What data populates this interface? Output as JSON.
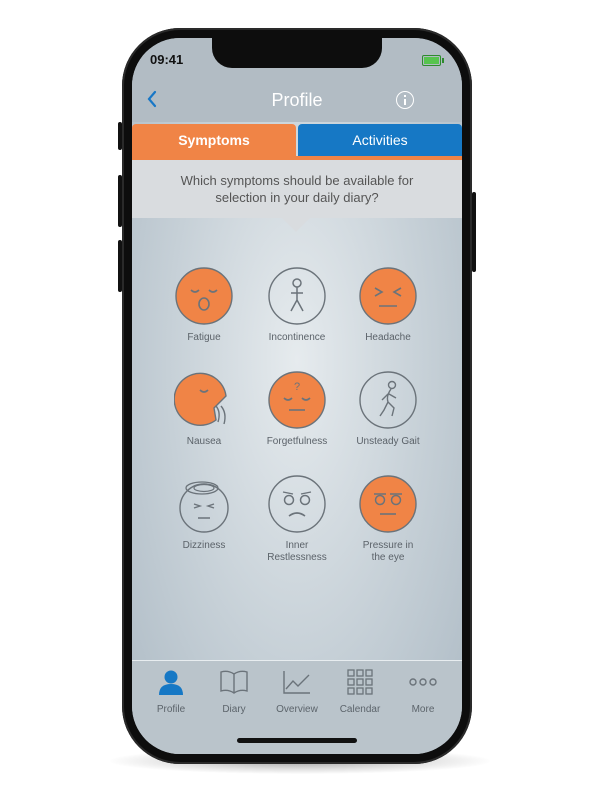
{
  "status_bar": {
    "time": "09:41"
  },
  "header": {
    "title": "Profile"
  },
  "tabs": [
    {
      "label": "Symptoms",
      "active": true
    },
    {
      "label": "Activities",
      "active": false
    }
  ],
  "question": "Which symptoms should be available for selection in your daily diary?",
  "symptoms": [
    {
      "label": "Fatigue",
      "selected": true
    },
    {
      "label": "Incontinence",
      "selected": false
    },
    {
      "label": "Headache",
      "selected": true
    },
    {
      "label": "Nausea",
      "selected": true
    },
    {
      "label": "Forgetfulness",
      "selected": true
    },
    {
      "label": "Unsteady Gait",
      "selected": false
    },
    {
      "label": "Dizziness",
      "selected": false
    },
    {
      "label": "Inner Restlessness",
      "selected": false
    },
    {
      "label": "Pressure in the eye",
      "selected": true
    }
  ],
  "nav": [
    {
      "label": "Profile",
      "icon": "person-icon",
      "active": true
    },
    {
      "label": "Diary",
      "icon": "book-icon",
      "active": false
    },
    {
      "label": "Overview",
      "icon": "line-chart-icon",
      "active": false
    },
    {
      "label": "Calendar",
      "icon": "calendar-grid-icon",
      "active": false
    },
    {
      "label": "More",
      "icon": "more-dots-icon",
      "active": false
    }
  ],
  "colors": {
    "accent_orange": "#f08446",
    "accent_blue": "#1678c5",
    "icon_gray": "#6b737a"
  }
}
